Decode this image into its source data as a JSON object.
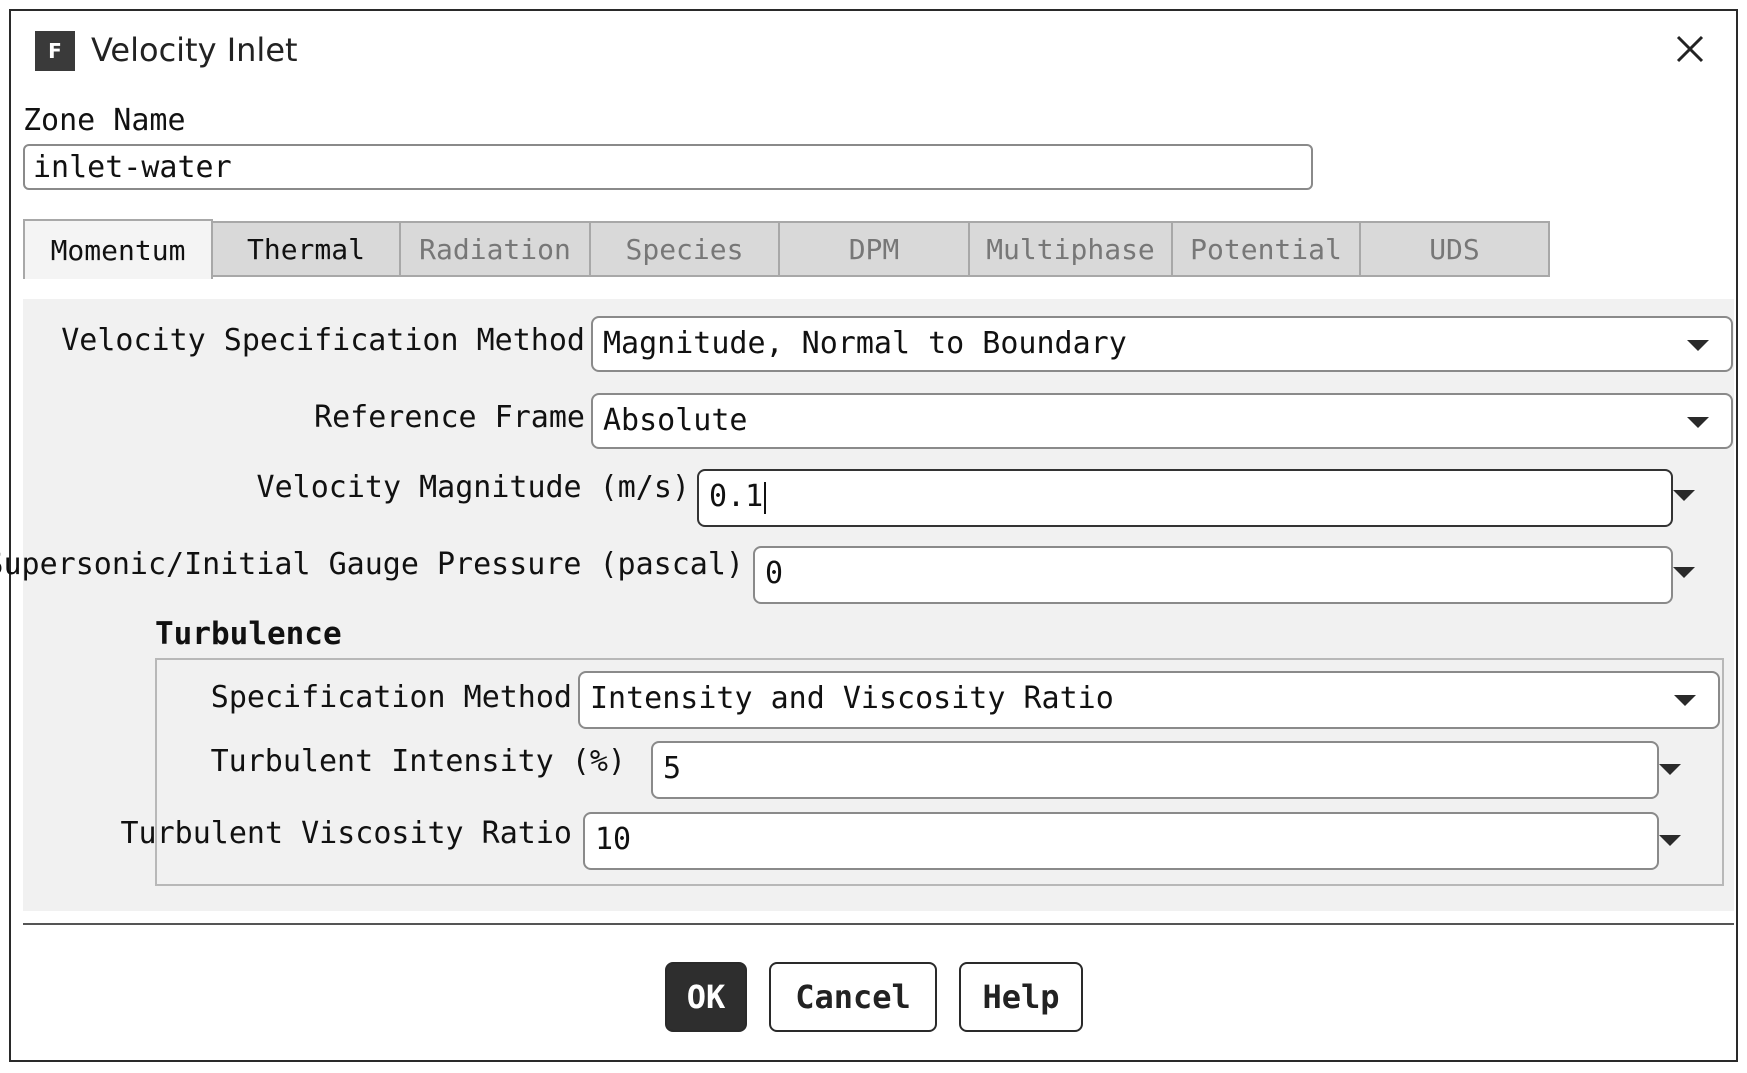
{
  "window": {
    "title": "Velocity Inlet",
    "app_icon_letter": "F"
  },
  "zone": {
    "label": "Zone Name",
    "value": "inlet-water"
  },
  "tabs": [
    {
      "label": "Momentum",
      "active": true
    },
    {
      "label": "Thermal",
      "active": false
    },
    {
      "label": "Radiation",
      "active": false
    },
    {
      "label": "Species",
      "active": false
    },
    {
      "label": "DPM",
      "active": false
    },
    {
      "label": "Multiphase",
      "active": false
    },
    {
      "label": "Potential",
      "active": false
    },
    {
      "label": "UDS",
      "active": false
    }
  ],
  "momentum": {
    "velocity_spec_label": "Velocity Specification Method",
    "velocity_spec_value": "Magnitude, Normal to Boundary",
    "reference_frame_label": "Reference Frame",
    "reference_frame_value": "Absolute",
    "velocity_magnitude_label": "Velocity Magnitude (m/s)",
    "velocity_magnitude_value": "0.1",
    "gauge_pressure_label": "Supersonic/Initial Gauge Pressure (pascal)",
    "gauge_pressure_value": "0"
  },
  "turbulence": {
    "title": "Turbulence",
    "spec_method_label": "Specification Method",
    "spec_method_value": "Intensity and Viscosity Ratio",
    "intensity_label": "Turbulent Intensity (%)",
    "intensity_value": "5",
    "viscosity_ratio_label": "Turbulent Viscosity Ratio",
    "viscosity_ratio_value": "10"
  },
  "buttons": {
    "ok": "OK",
    "cancel": "Cancel",
    "help": "Help"
  }
}
